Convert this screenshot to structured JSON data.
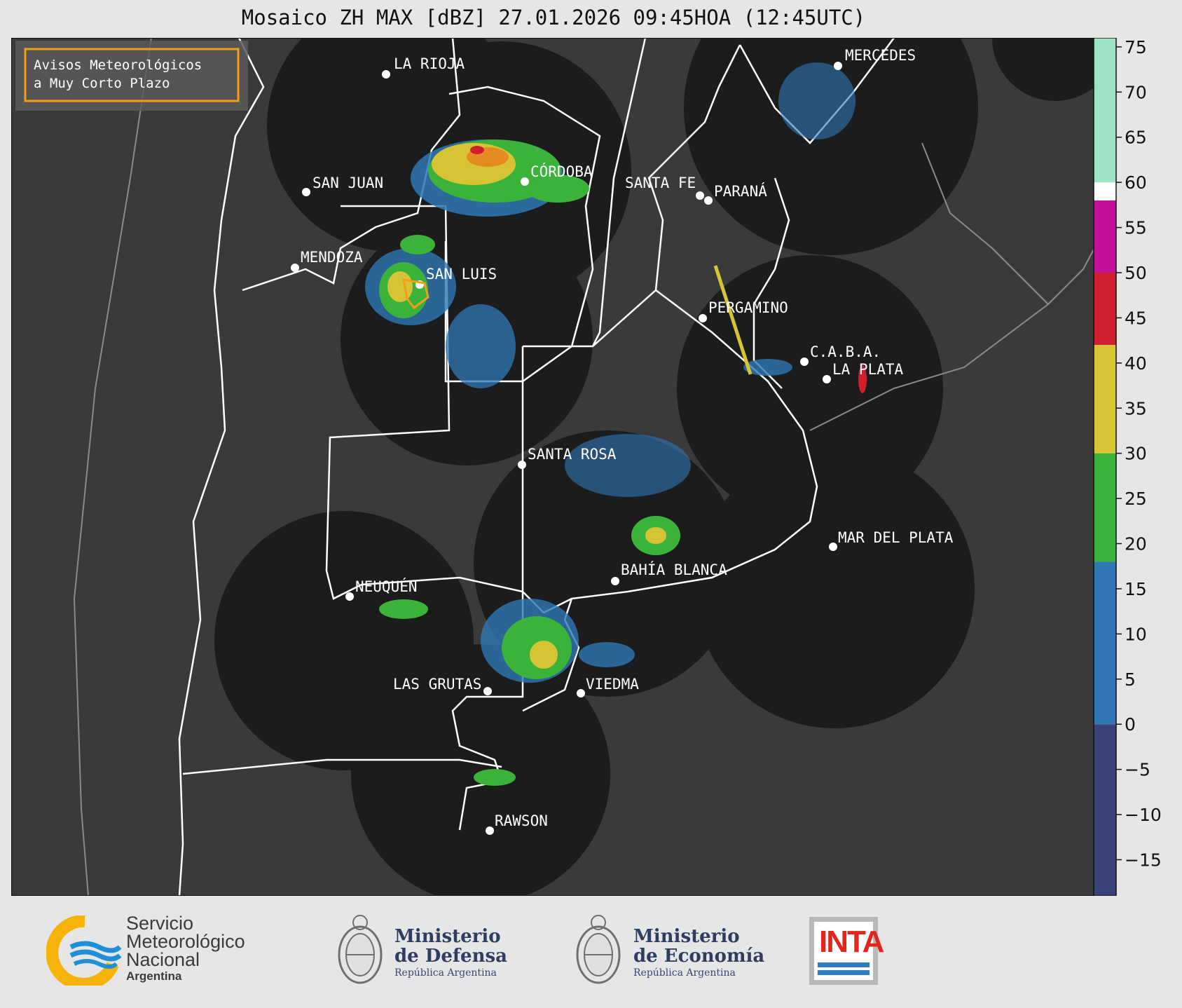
{
  "title": "Mosaico ZH MAX [dBZ] 27.01.2026 09:45HOA (12:45UTC)",
  "map": {
    "warning_box_line1": "Avisos Meteorológicos",
    "warning_box_line2": "a Muy Corto Plazo",
    "cities": [
      {
        "name": "LA RIOJA"
      },
      {
        "name": "SAN JUAN"
      },
      {
        "name": "CÓRDOBA"
      },
      {
        "name": "SANTA FE"
      },
      {
        "name": "PARANÁ"
      },
      {
        "name": "MERCEDES"
      },
      {
        "name": "MENDOZA"
      },
      {
        "name": "SAN LUIS"
      },
      {
        "name": "PERGAMINO"
      },
      {
        "name": "C.A.B.A."
      },
      {
        "name": "LA PLATA"
      },
      {
        "name": "SANTA ROSA"
      },
      {
        "name": "MAR DEL PLATA"
      },
      {
        "name": "BAHÍA BLANCA"
      },
      {
        "name": "NEUQUÉN"
      },
      {
        "name": "LAS GRUTAS"
      },
      {
        "name": "VIEDMA"
      },
      {
        "name": "RAWSON"
      }
    ]
  },
  "colorbar": {
    "ticks": [
      "75",
      "70",
      "65",
      "60",
      "55",
      "50",
      "45",
      "40",
      "35",
      "30",
      "25",
      "20",
      "15",
      "10",
      "5",
      "0",
      "−5",
      "−10",
      "−15"
    ],
    "min": -19,
    "max": 76,
    "bands": [
      {
        "from": -19,
        "to": 0,
        "color": "#3a4377"
      },
      {
        "from": 0,
        "to": 18,
        "color": "#2f78b5"
      },
      {
        "from": 18,
        "to": 30,
        "color": "#3bb33b"
      },
      {
        "from": 30,
        "to": 42,
        "color": "#d6c434"
      },
      {
        "from": 42,
        "to": 50,
        "color": "#d21f2f"
      },
      {
        "from": 50,
        "to": 58,
        "color": "#c2109a"
      },
      {
        "from": 58,
        "to": 60,
        "color": "#ffffff"
      },
      {
        "from": 60,
        "to": 76,
        "color": "#9ee3c6"
      }
    ]
  },
  "logos": {
    "smn_line1": "Servicio",
    "smn_line2": "Meteorológico",
    "smn_line3": "Nacional",
    "smn_line4": "Argentina",
    "defensa_line1": "Ministerio",
    "defensa_line2": "de Defensa",
    "defensa_line3": "República Argentina",
    "economia_line1": "Ministerio",
    "economia_line2": "de Economía",
    "economia_line3": "República Argentina",
    "inta": "INTA"
  }
}
